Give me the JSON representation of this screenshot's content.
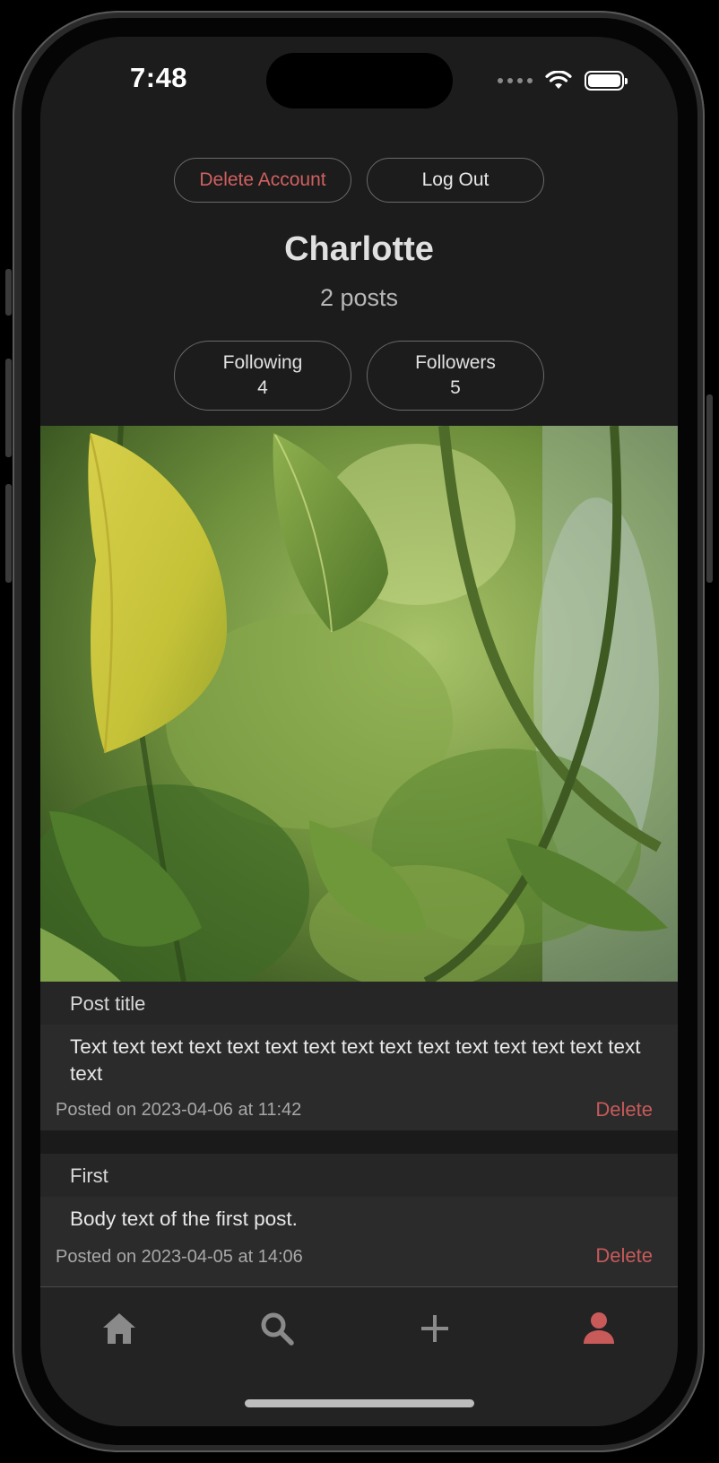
{
  "status_bar": {
    "time": "7:48"
  },
  "profile": {
    "delete_account_label": "Delete Account",
    "logout_label": "Log Out",
    "name": "Charlotte",
    "posts_count": "2 posts",
    "following": {
      "label": "Following",
      "count": "4"
    },
    "followers": {
      "label": "Followers",
      "count": "5"
    }
  },
  "posts": [
    {
      "title": "Post title",
      "body": "Text text text text text text text text text text text text text text text text",
      "meta": "Posted on 2023-04-06 at 11:42",
      "delete_label": "Delete",
      "has_image": true
    },
    {
      "title": "First",
      "body": "Body text of the first post.",
      "meta": "Posted on 2023-04-05 at 14:06",
      "delete_label": "Delete",
      "has_image": false
    }
  ],
  "tab_bar": {
    "items": [
      {
        "icon": "home-icon",
        "active": false
      },
      {
        "icon": "search-icon",
        "active": false
      },
      {
        "icon": "plus-icon",
        "active": false
      },
      {
        "icon": "person-icon",
        "active": true
      }
    ],
    "active_color": "#c85a5a",
    "inactive_color": "#8a8a8a"
  },
  "colors": {
    "danger": "#d06060",
    "background": "#1c1c1c"
  }
}
